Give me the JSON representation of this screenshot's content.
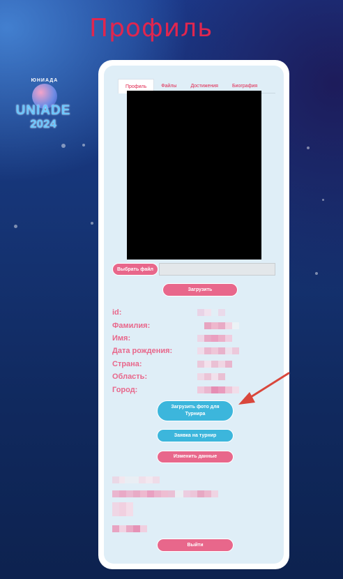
{
  "page": {
    "title": "Профиль"
  },
  "logo": {
    "arc_text": "ЮНИАДА",
    "name": "UNIADE",
    "year": "2024"
  },
  "tabs": [
    {
      "label": "Профиль",
      "active": true
    },
    {
      "label": "Файлы",
      "active": false
    },
    {
      "label": "Достижения",
      "active": false
    },
    {
      "label": "Биография",
      "active": false
    }
  ],
  "upload": {
    "choose_file_label": "Выбрать файл",
    "file_name": "",
    "upload_label": "Загрузить"
  },
  "profile_fields": [
    {
      "label": "id:"
    },
    {
      "label": "Фамилия:"
    },
    {
      "label": "Имя:"
    },
    {
      "label": "Дата рождения:"
    },
    {
      "label": "Страна:"
    },
    {
      "label": "Область:"
    },
    {
      "label": "Город:"
    }
  ],
  "actions": {
    "upload_tournament_photo": "Загрузить фото для Турнира",
    "tournament_application": "Заявка на турнир",
    "edit_data": "Изменить данные",
    "logout": "Выйти"
  },
  "colors": {
    "accent_pink": "#e8678b",
    "title_red": "#e0264f",
    "button_blue": "#3cb6dc",
    "card_bg": "#dfeef7",
    "arrow_red": "#d9473c"
  }
}
